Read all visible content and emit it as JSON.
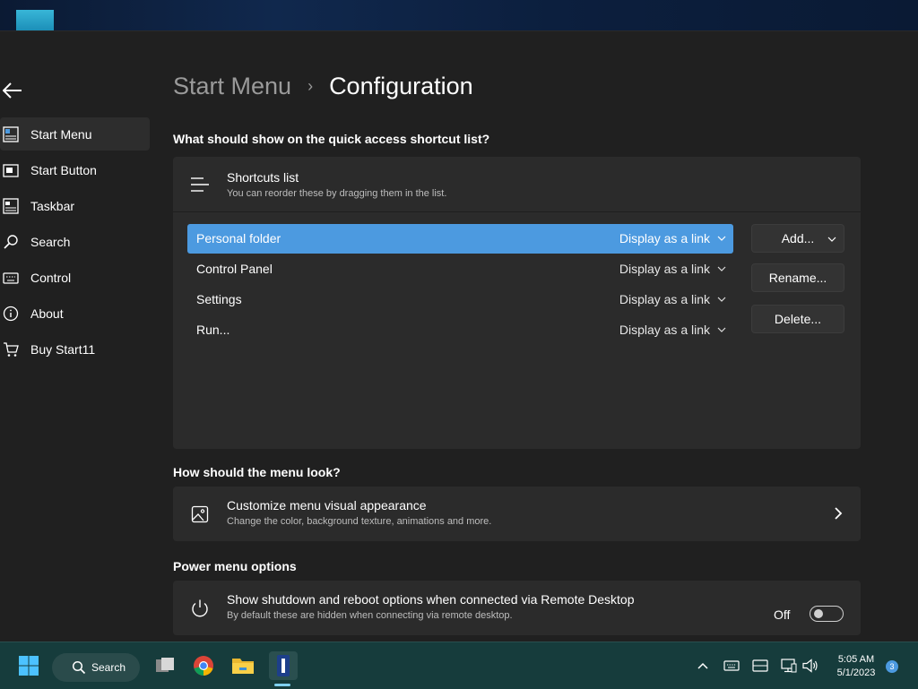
{
  "breadcrumb": {
    "parent": "Start Menu",
    "separator": "›",
    "current": "Configuration"
  },
  "sidebar": {
    "items": [
      {
        "label": "Start Menu",
        "icon": "start-menu-icon",
        "active": true
      },
      {
        "label": "Start Button",
        "icon": "start-button-icon",
        "active": false
      },
      {
        "label": "Taskbar",
        "icon": "taskbar-icon",
        "active": false
      },
      {
        "label": "Search",
        "icon": "search-icon",
        "active": false
      },
      {
        "label": "Control",
        "icon": "keyboard-icon",
        "active": false
      },
      {
        "label": "About",
        "icon": "info-icon",
        "active": false
      },
      {
        "label": "Buy Start11",
        "icon": "cart-icon",
        "active": false
      }
    ]
  },
  "shortcuts": {
    "question": "What should show on the quick access shortcut list?",
    "header_title": "Shortcuts list",
    "header_sub": "You can reorder these by dragging them in the list.",
    "items": [
      {
        "label": "Personal folder",
        "mode": "Display as a link",
        "selected": true
      },
      {
        "label": "Control Panel",
        "mode": "Display as a link",
        "selected": false
      },
      {
        "label": "Settings",
        "mode": "Display as a link",
        "selected": false
      },
      {
        "label": "Run...",
        "mode": "Display as a link",
        "selected": false
      }
    ],
    "buttons": {
      "add": "Add...",
      "rename": "Rename...",
      "delete": "Delete..."
    }
  },
  "appearance": {
    "section": "How should the menu look?",
    "title": "Customize menu visual appearance",
    "sub": "Change the color, background texture, animations and more."
  },
  "power": {
    "section": "Power menu options",
    "title": "Show shutdown and reboot options when connected via Remote Desktop",
    "sub": "By default these are hidden when connecting via remote desktop.",
    "toggle_label": "Off",
    "toggle_on": false
  },
  "taskbar": {
    "search_label": "Search",
    "time": "5:05 AM",
    "date": "5/1/2023",
    "notification_count": "3"
  },
  "colors": {
    "accent": "#4c9ae0",
    "background": "#202020",
    "card": "#2b2b2b",
    "taskbar": "#163c3c"
  }
}
